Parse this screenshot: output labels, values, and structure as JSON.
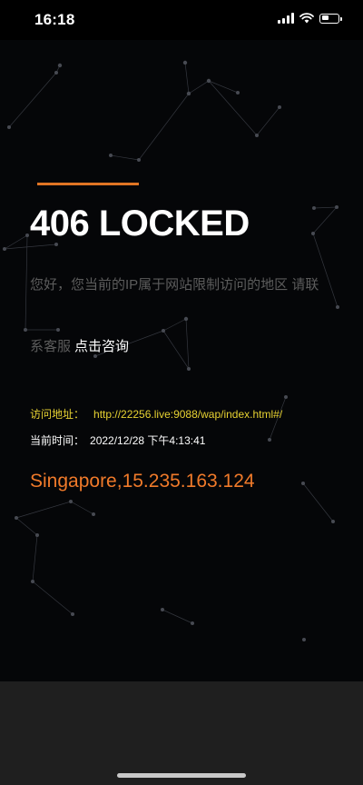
{
  "status_bar": {
    "time": "16:18"
  },
  "page": {
    "title": "406 LOCKED",
    "notice_line1": "您好，您当前的IP属于网站限制访问的地区 请联",
    "notice_line2_prefix": "系客服",
    "consult_link": "点击咨询",
    "visit_label": "访问地址：",
    "visit_url": "http://22256.live:9088/wap/index.html#/",
    "time_label": "当前时间：",
    "time_value": "2022/12/28 下午4:13:41",
    "ip_location": "Singapore,15.235.163.124"
  },
  "colors": {
    "accent": "#e07524",
    "ip_text": "#f07a2a",
    "url_text": "#e7d232",
    "panel_bg": "#050608",
    "muted_text": "#5c5c5c"
  }
}
